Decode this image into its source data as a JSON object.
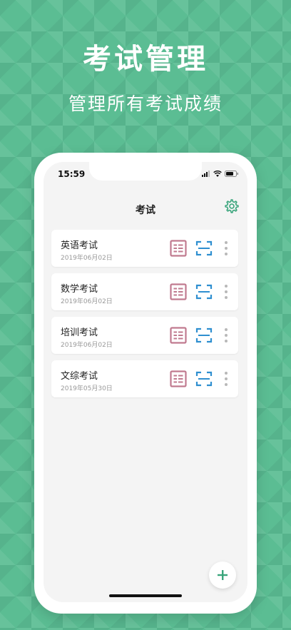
{
  "promo": {
    "title": "考试管理",
    "subtitle": "管理所有考试成绩"
  },
  "status_bar": {
    "time": "15:59"
  },
  "nav": {
    "title": "考试",
    "settings_icon": "gear-icon"
  },
  "exams": [
    {
      "name": "英语考试",
      "date": "2019年06月02日"
    },
    {
      "name": "数学考试",
      "date": "2019年06月02日"
    },
    {
      "name": "培训考试",
      "date": "2019年06月02日"
    },
    {
      "name": "文综考试",
      "date": "2019年05月30日"
    }
  ],
  "icons": {
    "report": "report-table-icon",
    "scan": "scan-icon",
    "more": "more-vertical-icon",
    "add": "plus-icon"
  },
  "colors": {
    "background": "#5bbd93",
    "accent": "#3aa57c",
    "report_icon": "#c07a8f",
    "scan_icon": "#2f8fd0"
  }
}
